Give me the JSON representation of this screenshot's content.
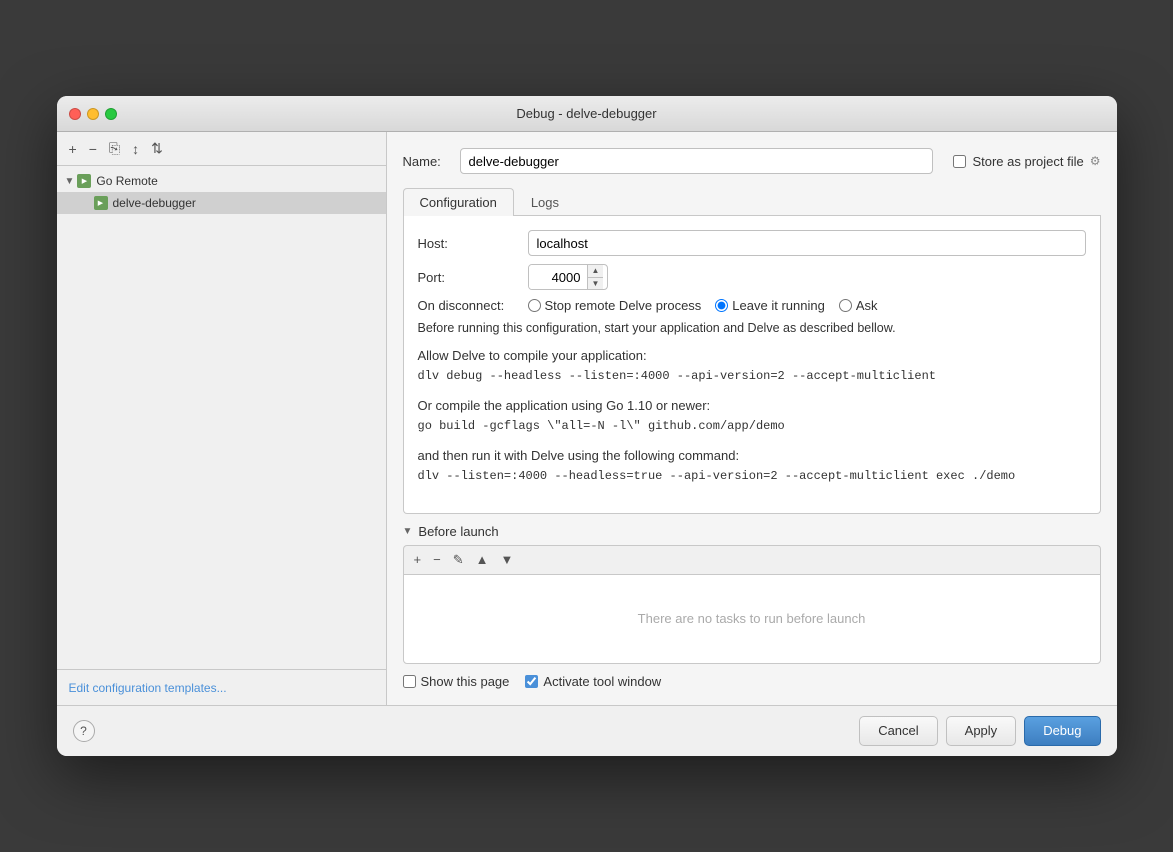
{
  "window": {
    "title": "Debug - delve-debugger"
  },
  "sidebar": {
    "toolbar": {
      "add_btn": "+",
      "remove_btn": "−",
      "copy_btn": "⎘",
      "move_btn": "↕",
      "sort_btn": "⇅"
    },
    "tree": {
      "group_label": "Go Remote",
      "item_label": "delve-debugger"
    },
    "footer_link": "Edit configuration templates..."
  },
  "main": {
    "name_label": "Name:",
    "name_value": "delve-debugger",
    "store_as_project_label": "Store as project file",
    "tabs": [
      {
        "label": "Configuration",
        "active": true
      },
      {
        "label": "Logs",
        "active": false
      }
    ],
    "form": {
      "host_label": "Host:",
      "host_value": "localhost",
      "port_label": "Port:",
      "port_value": "4000",
      "disconnect_label": "On disconnect:",
      "disconnect_options": [
        {
          "label": "Stop remote Delve process",
          "selected": false
        },
        {
          "label": "Leave it running",
          "selected": true
        },
        {
          "label": "Ask",
          "selected": false
        }
      ],
      "info_text": "Before running this configuration, start your application and Delve as described bellow.",
      "section1_title": "Allow Delve to compile your application:",
      "section1_code": "dlv debug --headless --listen=:4000 --api-version=2 --accept-multiclient",
      "section2_title": "Or compile the application using Go 1.10 or newer:",
      "section2_code": "go build -gcflags \\\"all=-N -l\\\" github.com/app/demo",
      "section3_title": "and then run it with Delve using the following command:",
      "section3_code": "dlv --listen=:4000 --headless=true --api-version=2 --accept-multiclient exec ./demo"
    },
    "before_launch": {
      "header": "Before launch",
      "toolbar": {
        "add": "+",
        "remove": "−",
        "edit": "✎",
        "up": "▲",
        "down": "▼"
      },
      "empty_text": "There are no tasks to run before launch"
    },
    "bottom": {
      "show_page_label": "Show this page",
      "activate_window_label": "Activate tool window",
      "show_page_checked": false,
      "activate_window_checked": true
    }
  },
  "footer": {
    "help_label": "?",
    "cancel_label": "Cancel",
    "apply_label": "Apply",
    "debug_label": "Debug"
  }
}
